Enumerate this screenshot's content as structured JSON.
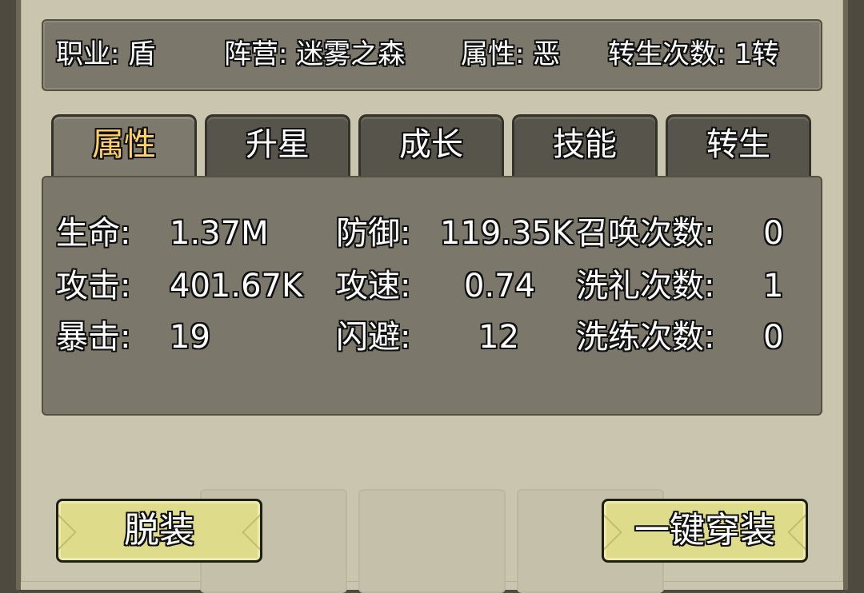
{
  "info": {
    "job": "职业: 盾",
    "camp": "阵营: 迷雾之森",
    "attr": "属性: 恶",
    "rebirth": "转生次数: 1转"
  },
  "tabs": [
    {
      "label": "属性",
      "active": true
    },
    {
      "label": "升星",
      "active": false
    },
    {
      "label": "成长",
      "active": false
    },
    {
      "label": "技能",
      "active": false
    },
    {
      "label": "转生",
      "active": false
    }
  ],
  "stats": {
    "hp_label": "生命:",
    "hp_value": "1.37M",
    "def_label": "防御:",
    "def_value": "119.35K",
    "summon_label": "召唤次数:",
    "summon_value": "0",
    "atk_label": "攻击:",
    "atk_value": "401.67K",
    "aspd_label": "攻速:",
    "aspd_value": "0.74",
    "baptism_label": "洗礼次数:",
    "baptism_value": "1",
    "crit_label": "暴击:",
    "crit_value": "19",
    "dodge_label": "闪避:",
    "dodge_value": "12",
    "refine_label": "洗练次数:",
    "refine_value": "0"
  },
  "buttons": {
    "unequip": "脱装",
    "equip_all": "一键穿装"
  },
  "colors": {
    "active_tab_text": "#ffd36b",
    "button_bg": "#dedb8a",
    "panel_bg": "#7b776a"
  }
}
